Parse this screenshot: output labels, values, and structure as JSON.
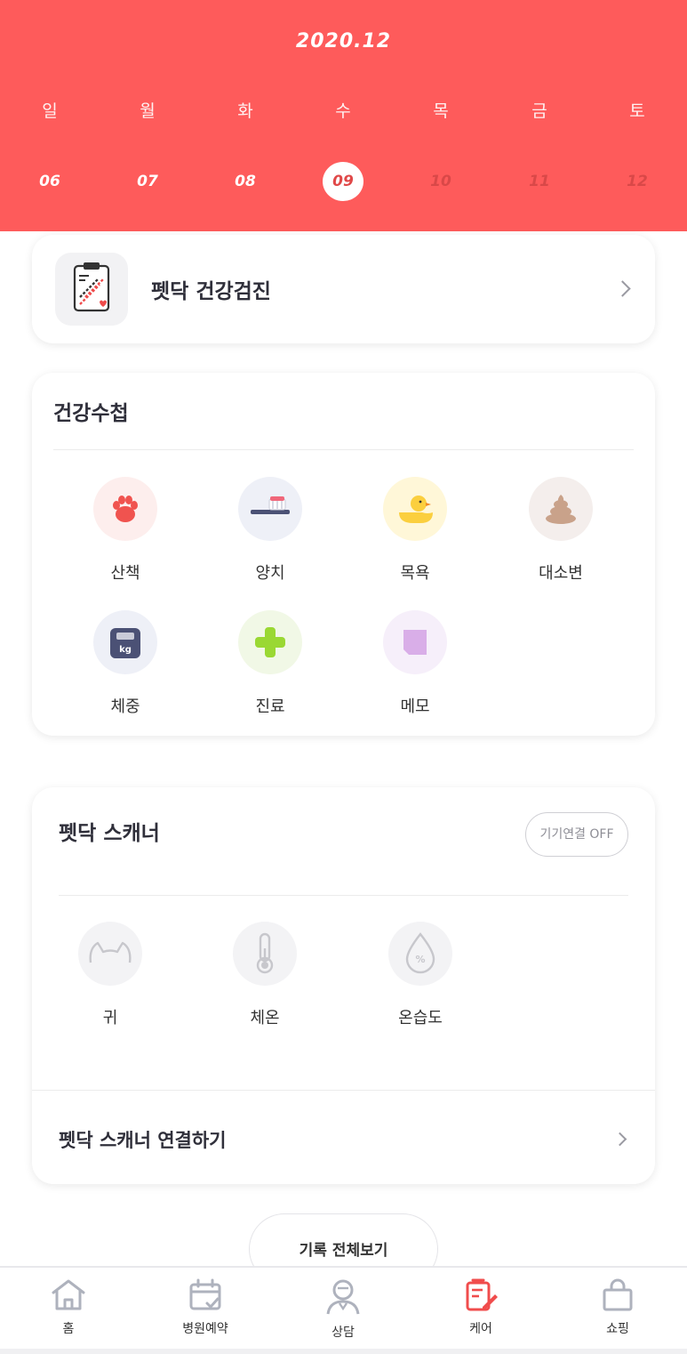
{
  "calendar": {
    "month": "2020.12",
    "weekdays": [
      "일",
      "월",
      "화",
      "수",
      "목",
      "금",
      "토"
    ],
    "dates": [
      "06",
      "07",
      "08",
      "09",
      "10",
      "11",
      "12"
    ],
    "selected_date": "09"
  },
  "checkup": {
    "title": "펫닥 건강검진"
  },
  "health_notebook": {
    "title": "건강수첩",
    "items": [
      {
        "label": "산책",
        "icon": "paw-icon"
      },
      {
        "label": "양치",
        "icon": "toothbrush-icon"
      },
      {
        "label": "목욕",
        "icon": "duck-icon"
      },
      {
        "label": "대소변",
        "icon": "poop-icon"
      },
      {
        "label": "체중",
        "icon": "scale-icon"
      },
      {
        "label": "진료",
        "icon": "plus-icon"
      },
      {
        "label": "메모",
        "icon": "memo-icon"
      }
    ]
  },
  "scanner": {
    "title": "펫닥 스캐너",
    "device_status": "기기연결 OFF",
    "items": [
      {
        "label": "귀",
        "icon": "ear-icon"
      },
      {
        "label": "체온",
        "icon": "thermometer-icon"
      },
      {
        "label": "온습도",
        "icon": "humidity-icon"
      }
    ],
    "connect_label": "펫닥 스캐너 연결하기"
  },
  "view_all": "기록 전체보기",
  "bottom_nav": [
    {
      "label": "홈",
      "icon": "home-icon"
    },
    {
      "label": "병원예약",
      "icon": "calendar-icon"
    },
    {
      "label": "상담",
      "icon": "consult-icon"
    },
    {
      "label": "케어",
      "icon": "care-icon",
      "active": true
    },
    {
      "label": "쇼핑",
      "icon": "shopping-bag-icon"
    }
  ],
  "colors": {
    "brand": "#fe5b5b",
    "active_nav": "#f04c4c",
    "inactive_nav": "#aeb2bd"
  }
}
